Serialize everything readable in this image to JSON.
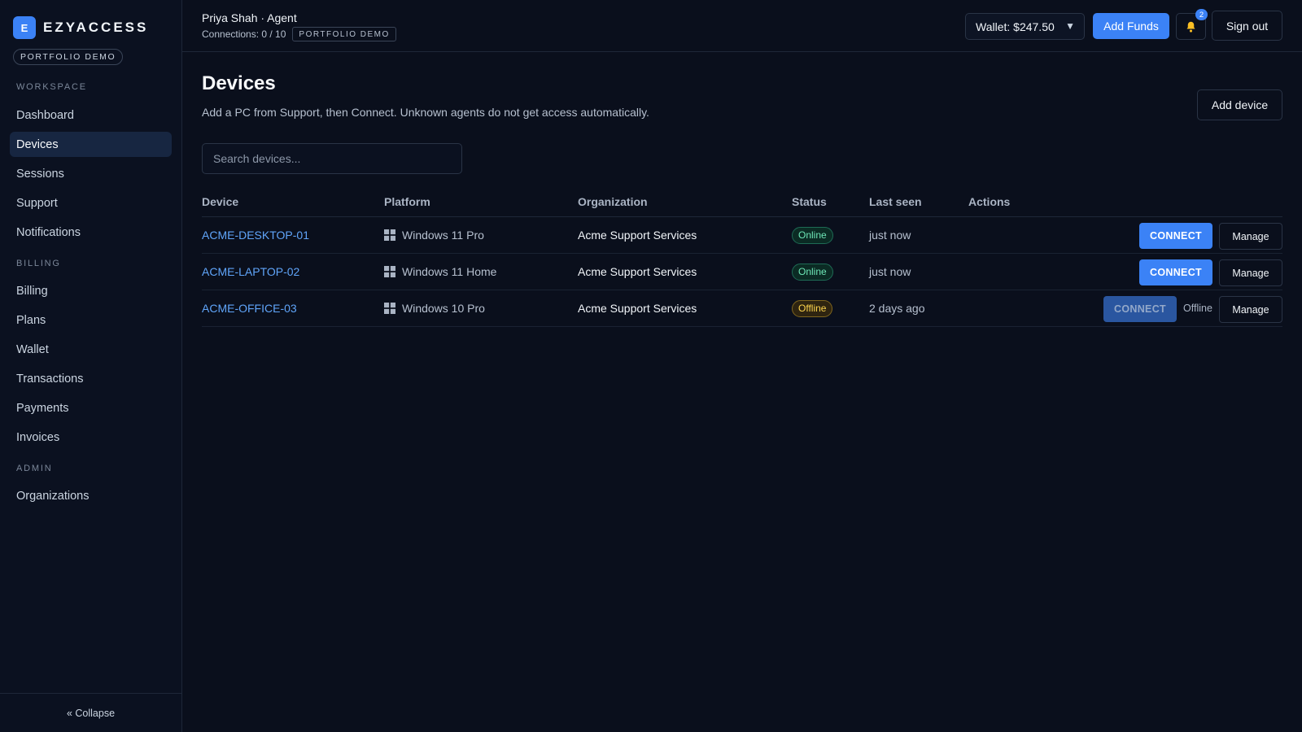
{
  "brand": {
    "logo_letter": "E",
    "name": "EZYACCESS",
    "demo_label": "PORTFOLIO DEMO"
  },
  "sidebar": {
    "sections": [
      {
        "label": "WORKSPACE",
        "items": [
          "Dashboard",
          "Devices",
          "Sessions",
          "Support",
          "Notifications"
        ]
      },
      {
        "label": "BILLING",
        "items": [
          "Billing",
          "Plans",
          "Wallet",
          "Transactions",
          "Payments",
          "Invoices"
        ]
      },
      {
        "label": "ADMIN",
        "items": [
          "Organizations"
        ]
      }
    ],
    "active_item": "Devices",
    "collapse_label": "« Collapse"
  },
  "header": {
    "user_line": "Priya Shah · Agent",
    "connections": "Connections: 0 / 10",
    "demo_tag": "PORTFOLIO DEMO",
    "wallet_label": "Wallet: $247.50",
    "add_funds_label": "Add Funds",
    "notification_count": "2",
    "sign_out_label": "Sign out"
  },
  "main": {
    "title": "Devices",
    "subtitle": "Add a PC from Support, then Connect. Unknown agents do not get access automatically.",
    "add_device_label": "Add device",
    "search_placeholder": "Search devices...",
    "columns": [
      "Device",
      "Platform",
      "Organization",
      "Status",
      "Last seen",
      "Actions"
    ],
    "rows": [
      {
        "device": "ACME-DESKTOP-01",
        "platform": "Windows 11 Pro",
        "organization": "Acme Support Services",
        "status": "Online",
        "last_seen": "just now",
        "connect": "CONNECT",
        "connect_enabled": true,
        "note": "",
        "manage": "Manage"
      },
      {
        "device": "ACME-LAPTOP-02",
        "platform": "Windows 11 Home",
        "organization": "Acme Support Services",
        "status": "Online",
        "last_seen": "just now",
        "connect": "CONNECT",
        "connect_enabled": true,
        "note": "",
        "manage": "Manage"
      },
      {
        "device": "ACME-OFFICE-03",
        "platform": "Windows 10 Pro",
        "organization": "Acme Support Services",
        "status": "Offline",
        "last_seen": "2 days ago",
        "connect": "CONNECT",
        "connect_enabled": false,
        "note": "Offline",
        "manage": "Manage"
      }
    ]
  },
  "colors": {
    "accent": "#3b82f6",
    "background": "#0a0f1c",
    "online": "#6ee7b7",
    "offline": "#fcd34d"
  }
}
